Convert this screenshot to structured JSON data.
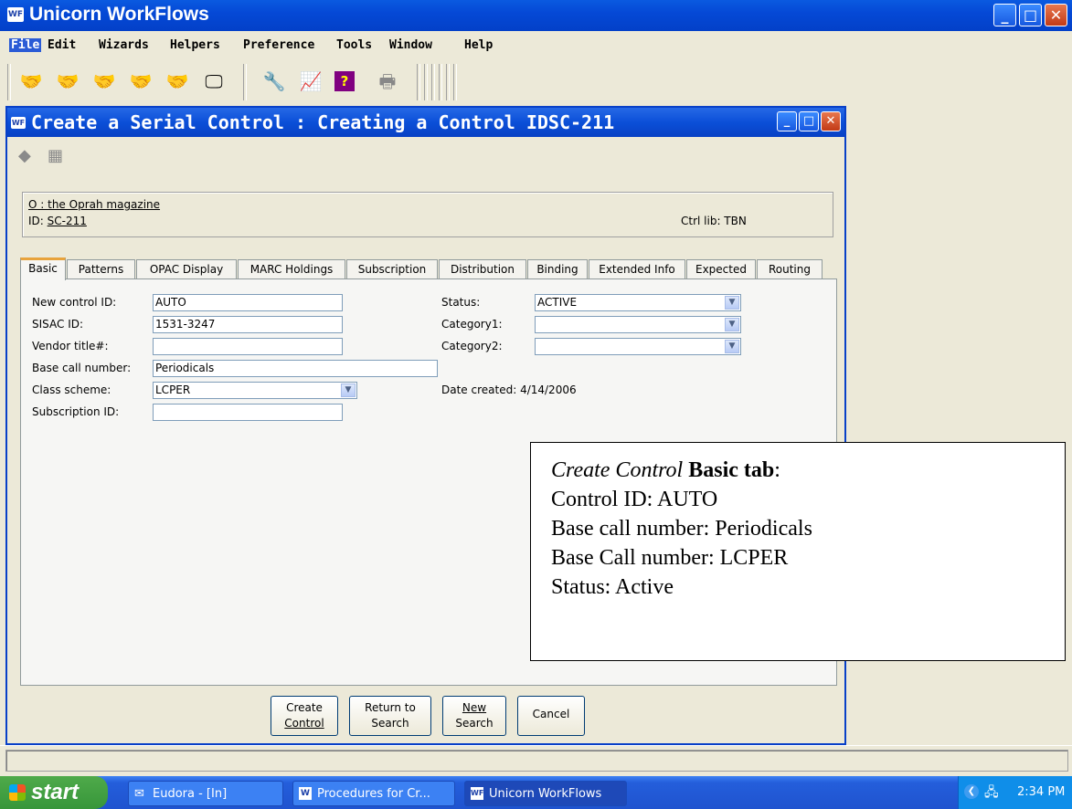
{
  "app": {
    "title": "Unicorn WorkFlows",
    "icon": "WF"
  },
  "menu": [
    "File",
    "Edit",
    "Wizards",
    "Helpers",
    "Preference",
    "Tools",
    "Window",
    "Help"
  ],
  "toolbar_icons": [
    "user-remove-icon",
    "user-add-icon",
    "user-modify-icon",
    "user-edit-icon",
    "user-delete-icon",
    "display-icon",
    "tools-icon",
    "report-icon",
    "help-icon",
    "print-icon"
  ],
  "dialog": {
    "title": "Create a Serial Control : Creating a Control IDSC-211",
    "record_title": "O : the Oprah magazine",
    "id_label": "ID:",
    "id_value": "SC-211",
    "ctrl_lib": "Ctrl lib: TBN"
  },
  "tabs": [
    "Basic",
    "Patterns",
    "OPAC Display",
    "MARC Holdings",
    "Subscription",
    "Distribution",
    "Binding",
    "Extended Info",
    "Expected",
    "Routing"
  ],
  "form": {
    "new_control_id": {
      "label": "New control ID:",
      "value": "AUTO"
    },
    "sisac_id": {
      "label": "SISAC ID:",
      "value": "1531-3247"
    },
    "vendor_title": {
      "label": "Vendor title#:",
      "value": ""
    },
    "base_call": {
      "label": "Base call number:",
      "value": "Periodicals"
    },
    "class_scheme": {
      "label": "Class scheme:",
      "value": "LCPER"
    },
    "subscription_id": {
      "label": "Subscription ID:",
      "value": ""
    },
    "status": {
      "label": "Status:",
      "value": "ACTIVE"
    },
    "category1": {
      "label": "Category1:",
      "value": ""
    },
    "category2": {
      "label": "Category2:",
      "value": ""
    },
    "date_created": "Date created: 4/14/2006"
  },
  "buttons": {
    "create": [
      "Create",
      "Control"
    ],
    "return": [
      "Return to",
      "Search"
    ],
    "new": [
      "New",
      "Search"
    ],
    "cancel": "Cancel"
  },
  "note": {
    "heading_italic": "Create Control",
    "heading_bold": "Basic tab",
    "lines": [
      "Control ID: AUTO",
      "Base call number: Periodicals",
      "Base Call number: LCPER",
      "Status: Active"
    ]
  },
  "taskbar": {
    "start": "start",
    "tasks": [
      "Eudora - [In]",
      "Procedures for Cr...",
      "Unicorn WorkFlows"
    ],
    "clock": "2:34 PM"
  },
  "colors": {
    "titlebar": "#0549d6",
    "close": "#c23a16",
    "active_tab_accent": "#e8a33c",
    "taskbar": "#245edb",
    "start": "#37963a"
  }
}
